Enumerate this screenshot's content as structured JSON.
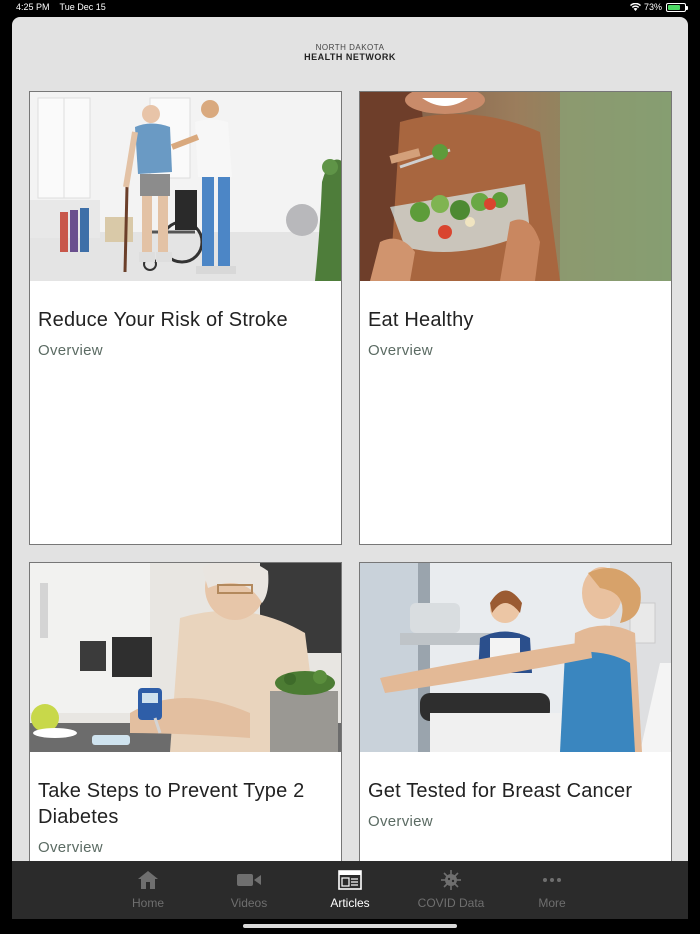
{
  "status_bar": {
    "time": "4:25 PM",
    "date": "Tue Dec 15",
    "battery": "73%",
    "battery_level": 0.73
  },
  "header": {
    "logo_line1": "NORTH DAKOTA",
    "logo_line2": "HEALTH NETWORK"
  },
  "articles": [
    {
      "title": "Reduce Your Risk of Stroke",
      "subtitle": "Overview",
      "image": "stroke-rehab-photo"
    },
    {
      "title": "Eat Healthy",
      "subtitle": "Overview",
      "image": "salad-bowl-photo"
    },
    {
      "title": "Take Steps to Prevent Type 2 Diabetes",
      "subtitle": "Overview",
      "image": "glucose-meter-photo"
    },
    {
      "title": "Get Tested for Breast Cancer",
      "subtitle": "Overview",
      "image": "mammogram-photo"
    }
  ],
  "tabbar": {
    "tabs": [
      {
        "label": "Home",
        "icon": "home-icon",
        "active": false
      },
      {
        "label": "Videos",
        "icon": "video-camera-icon",
        "active": false
      },
      {
        "label": "Articles",
        "icon": "articles-icon",
        "active": true
      },
      {
        "label": "COVID Data",
        "icon": "virus-icon",
        "active": false
      },
      {
        "label": "More",
        "icon": "more-dots-icon",
        "active": false
      }
    ]
  },
  "colors": {
    "background": "#e2e2e2",
    "tabbar": "#2b2b2b",
    "subtitle": "#5b6b63"
  }
}
